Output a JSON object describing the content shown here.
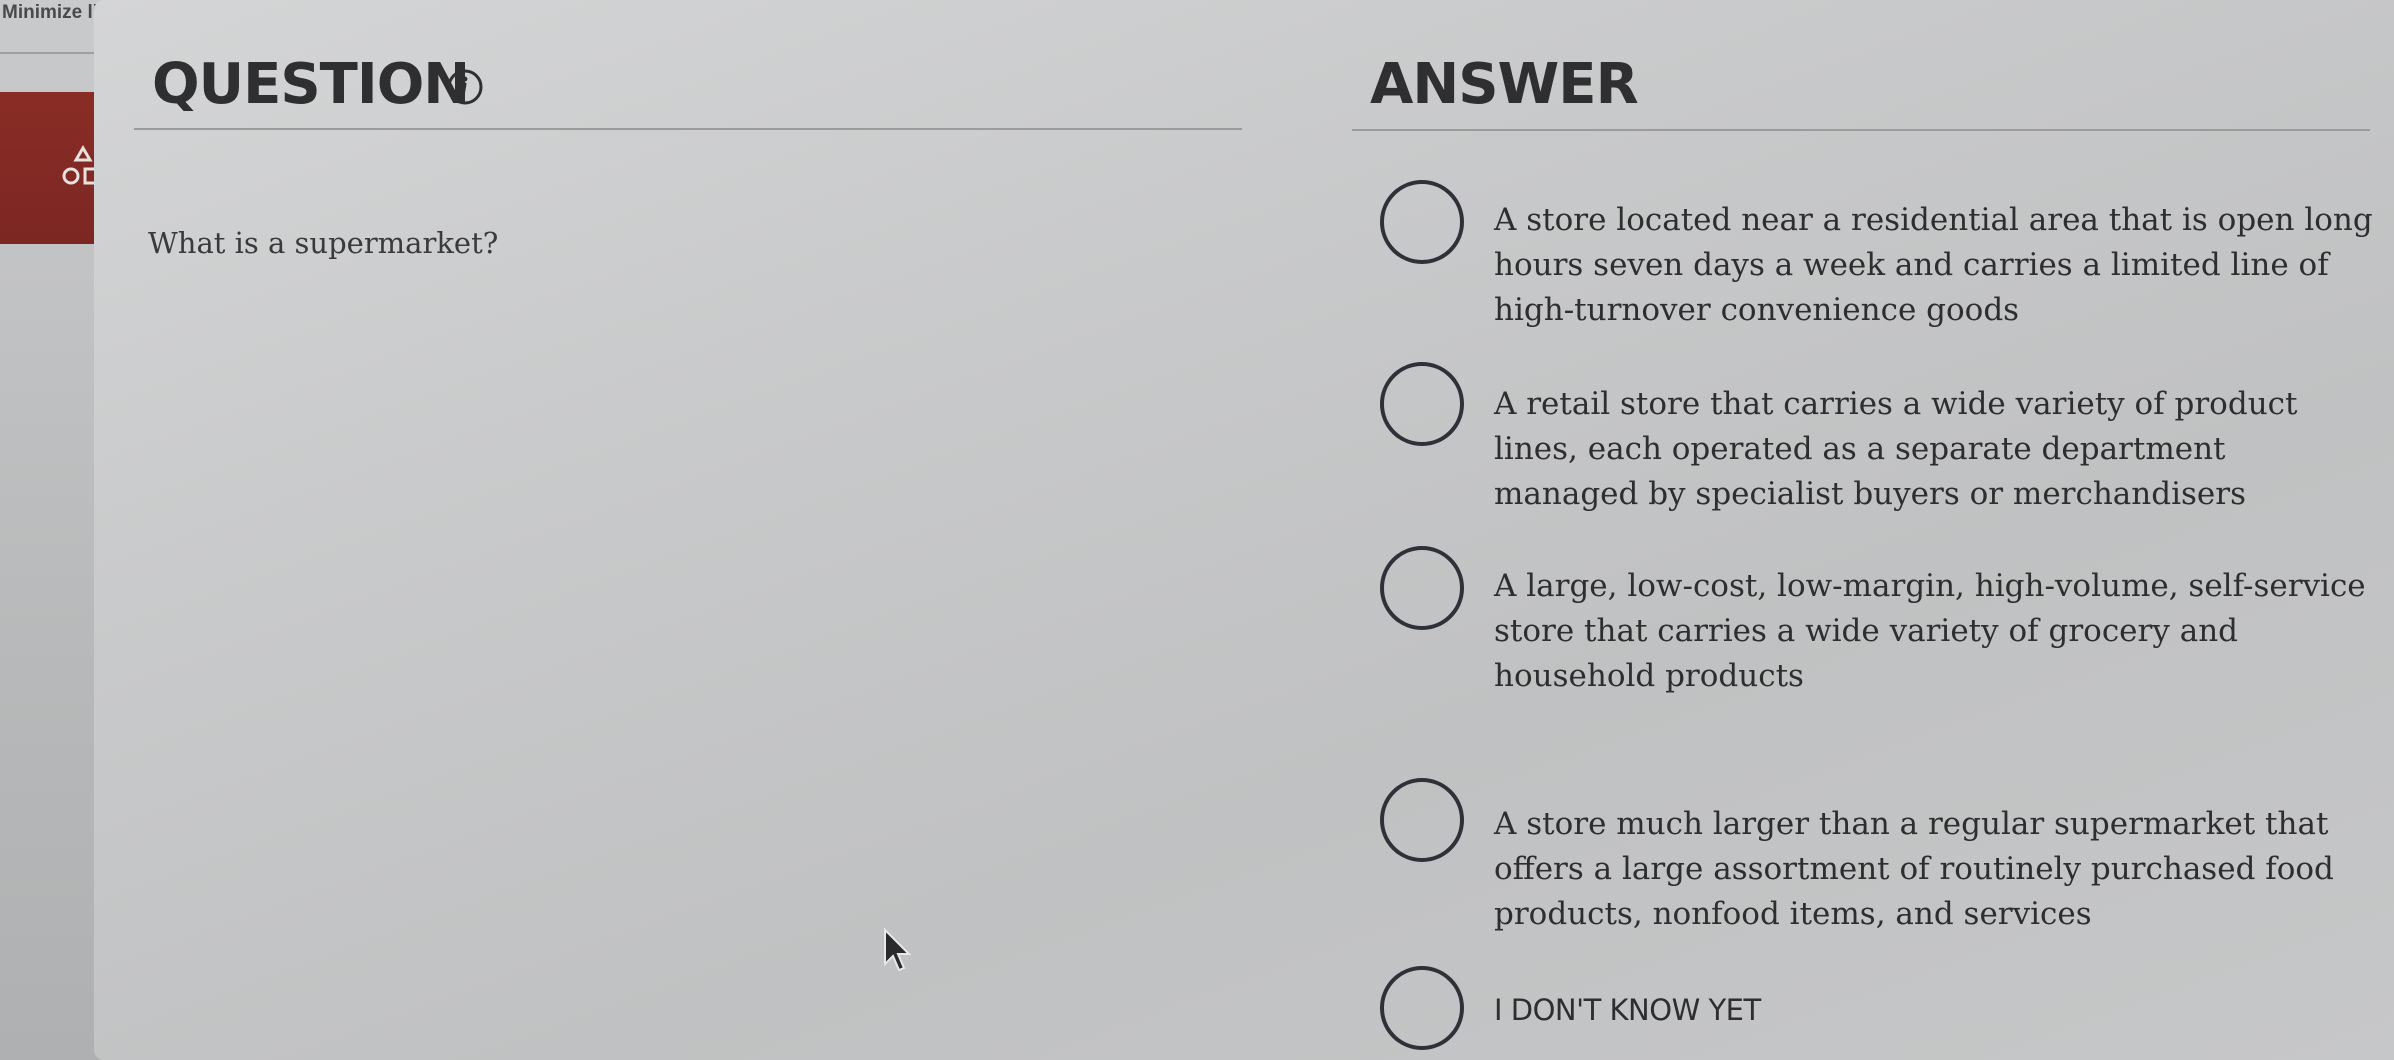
{
  "sidebar": {
    "minimize_label": "Minimize li",
    "icon": "shapes-icon"
  },
  "question": {
    "heading": "QUESTION",
    "info_icon": "info-icon",
    "text": "What is a supermarket?"
  },
  "answer": {
    "heading": "ANSWER",
    "options": [
      {
        "label": "A store located near a residential area that is open long hours seven days a week and carries a limited line of high-turnover convenience goods"
      },
      {
        "label": "A retail store that carries a wide variety of product lines, each operated as a separate department managed by specialist buyers or merchandisers"
      },
      {
        "label": "A large, low-cost, low-margin, high-volume, self-service store that carries a wide variety of grocery and household products"
      },
      {
        "label": "A store much larger than a regular supermarket that offers a large assortment of routinely purchased food products, nonfood items, and services"
      },
      {
        "label": "I DON'T KNOW YET"
      }
    ]
  },
  "colors": {
    "accent_red": "#8a2c26",
    "text_dark": "#2f2f31",
    "background": "#c8c9ca"
  }
}
